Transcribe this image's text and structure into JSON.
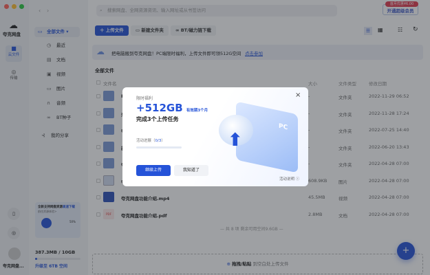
{
  "window": {
    "traffic_colors": [
      "#ff5f57",
      "#febc2e",
      "#28c840"
    ]
  },
  "app": {
    "name": "夸克网盘",
    "rail": [
      {
        "label": "云文件",
        "icon": "folder-icon"
      },
      {
        "label": "传输",
        "icon": "transfer-icon"
      }
    ],
    "user_name": "夸克网盘..."
  },
  "search": {
    "placeholder": "搜索网盘、全网资源资讯、输入网址或从书签访问"
  },
  "vip": {
    "badge": "首月优惠¥6.00",
    "label": "开通超级会员"
  },
  "sidebar": {
    "items": [
      {
        "label": "全部文件",
        "icon": "folder-icon"
      },
      {
        "label": "最近",
        "icon": "clock-icon"
      },
      {
        "label": "文档",
        "icon": "doc-icon"
      },
      {
        "label": "视频",
        "icon": "video-icon"
      },
      {
        "label": "图片",
        "icon": "image-icon"
      },
      {
        "label": "音频",
        "icon": "headphones-icon"
      },
      {
        "label": "BT种子",
        "icon": "link-icon"
      },
      {
        "label": "我的分享",
        "icon": "share-icon"
      }
    ],
    "promo": {
      "title": "全新支持网盘资源",
      "link": "高速下载",
      "sub": "前往资源体验>",
      "percent": "50%"
    },
    "storage": {
      "used": "387.3MB / 10GB",
      "upgrade": "升级至 6TB 空间",
      "percent": 3.8
    }
  },
  "toolbar": {
    "upload": "上传文件",
    "new_folder": "新建文件夹",
    "bt": "BT/磁力链下载"
  },
  "banner": {
    "text": "把电脑搬到夸克网盘！PC端限时福利，上传文件即可领512G空间",
    "link": "点击参加"
  },
  "main": {
    "title": "全部文件",
    "columns": [
      "文件名",
      "大小",
      "文件类型",
      "修改日期"
    ],
    "rows": [
      {
        "name": "P",
        "size": "-",
        "type": "文件夹",
        "date": "2022-11-29 06:52",
        "kind": "folder"
      },
      {
        "name": "来",
        "size": "-",
        "type": "文件夹",
        "date": "2022-11-28 17:24",
        "kind": "folder"
      },
      {
        "name": "夸",
        "size": "-",
        "type": "文件夹",
        "date": "2022-07-25 14:40",
        "kind": "folder"
      },
      {
        "name": "新",
        "size": "-",
        "type": "文件夹",
        "date": "2022-06-20 13:43",
        "kind": "folder"
      },
      {
        "name": "夸",
        "size": "-",
        "type": "文件夹",
        "date": "2022-04-28 07:00",
        "kind": "folder"
      },
      {
        "name": "夸",
        "size": "608.9KB",
        "type": "图片",
        "date": "2022-04-28 07:00",
        "kind": "image"
      },
      {
        "name": "夸克网盘功能介绍.mp4",
        "size": "45.5MB",
        "type": "视频",
        "date": "2022-04-28 07:00",
        "kind": "video"
      },
      {
        "name": "夸克网盘功能介绍.pdf",
        "size": "2.8MB",
        "type": "文档",
        "date": "2022-04-28 07:00",
        "kind": "pdf"
      }
    ],
    "footer": "— 共 8 项 剩余可用空间9.6GB —",
    "drop_bold": "拖拽/粘贴",
    "drop_text": "到空白处上传文件"
  },
  "modal": {
    "kicker": "限时福利",
    "amount": "+512GB",
    "validity": "有效期3个月",
    "task": "完成3个上传任务",
    "progress_label": "活动进展（",
    "progress_value": "0/3",
    "progress_end": "）",
    "progress_fraction": 0,
    "primary": "继续上传",
    "secondary": "我知道了",
    "rules": "活动说明 ⓘ",
    "close": "×",
    "pc_label": "PC"
  },
  "colors": {
    "accent": "#2553d8",
    "folder": "#7b9ad8"
  }
}
